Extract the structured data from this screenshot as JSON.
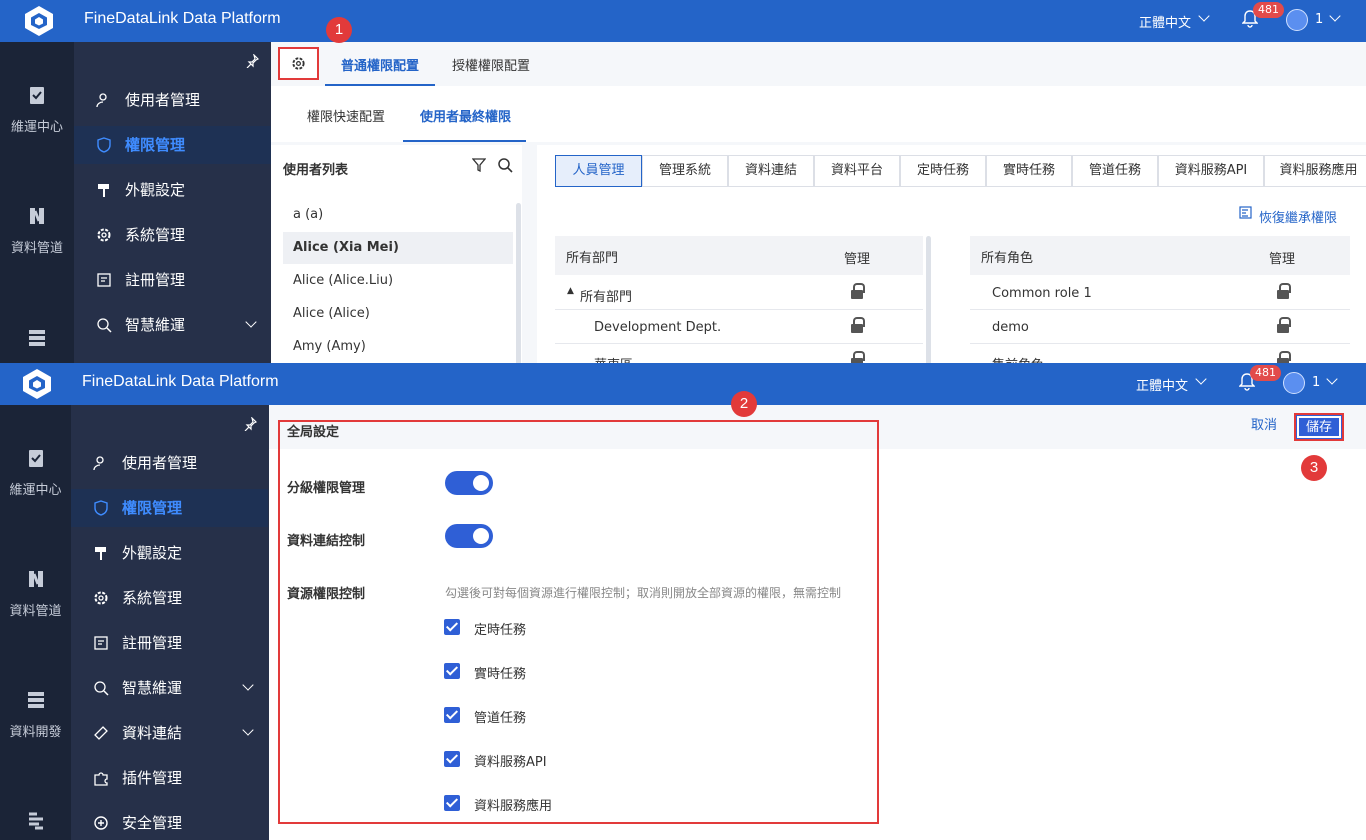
{
  "app": {
    "title": "FineDataLink Data Platform",
    "language": "正體中文",
    "notifications": "481",
    "user": "1"
  },
  "rail": [
    {
      "label": "維運中心",
      "icon": "clipboard-check-icon"
    },
    {
      "label": "資料管道",
      "icon": "pipeline-icon"
    },
    {
      "label": "資料開發",
      "icon": "database-icon"
    }
  ],
  "menu": [
    {
      "label": "使用者管理",
      "icon": "user-icon"
    },
    {
      "label": "權限管理",
      "icon": "shield-icon",
      "active": true
    },
    {
      "label": "外觀設定",
      "icon": "paint-roller-icon"
    },
    {
      "label": "系統管理",
      "icon": "gear-icon"
    },
    {
      "label": "註冊管理",
      "icon": "register-icon"
    },
    {
      "label": "智慧維運",
      "icon": "smart-ops-icon",
      "expandable": true
    },
    {
      "label": "資料連結",
      "icon": "link-icon",
      "expandable": true
    },
    {
      "label": "插件管理",
      "icon": "puzzle-icon"
    },
    {
      "label": "安全管理",
      "icon": "security-icon"
    }
  ],
  "tabs": {
    "general": "普通權限配置",
    "grant": "授權權限配置"
  },
  "subtabs": {
    "quick": "權限快速配置",
    "final": "使用者最終權限"
  },
  "userlist": {
    "title": "使用者列表",
    "items": [
      "a (a)",
      "Alice (Xia Mei)",
      "Alice (Alice.Liu)",
      "Alice (Alice)",
      "Amy (Amy)"
    ]
  },
  "perm_tabs": [
    "人員管理",
    "管理系統",
    "資料連結",
    "資料平台",
    "定時任務",
    "實時任務",
    "管道任務",
    "資料服務API",
    "資料服務應用"
  ],
  "restore_link": "恢復繼承權限",
  "dept_table": {
    "col1": "所有部門",
    "col2": "管理",
    "rows": [
      "所有部門",
      "Development Dept.",
      "華東區"
    ]
  },
  "role_table": {
    "col1": "所有角色",
    "col2": "管理",
    "rows": [
      "Common role 1",
      "demo",
      "售前角色"
    ]
  },
  "global_settings": {
    "title": "全局設定",
    "hierarchy_label": "分級權限管理",
    "hierarchy_on": true,
    "connection_label": "資料連結控制",
    "connection_on": true,
    "resource_label": "資源權限控制",
    "resource_hint": "勾選後可對每個資源進行權限控制；取消則開放全部資源的權限，無需控制",
    "resources": [
      "定時任務",
      "實時任務",
      "管道任務",
      "資料服務API",
      "資料服務應用"
    ]
  },
  "buttons": {
    "cancel": "取消",
    "save": "儲存"
  },
  "callouts": [
    "1",
    "2",
    "3"
  ],
  "colors": {
    "topbar": "#2464c8",
    "sidebar": "#263049",
    "rail": "#1b2437",
    "accent": "#2f5fd6",
    "callout": "#e23a3a"
  }
}
